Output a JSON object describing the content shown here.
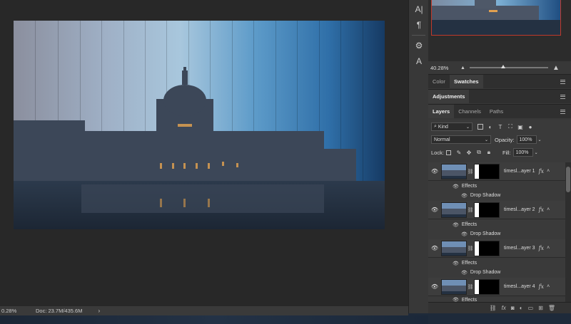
{
  "status": {
    "zoom": "0.28%",
    "doc": "Doc: 23.7M/435.6M",
    "arrow": "›"
  },
  "toolbar": {
    "icons": [
      "A|",
      "¶",
      "⚙",
      "A"
    ]
  },
  "navigator": {
    "zoom_value": "40.28%"
  },
  "tabs_top": [
    "Color",
    "Swatches"
  ],
  "tabs_mid": [
    "Adjustments"
  ],
  "tabs_layers": [
    "Layers",
    "Channels",
    "Paths"
  ],
  "layers": {
    "filter_kind": "Kind",
    "blend_mode": "Normal",
    "opacity_label": "Opacity:",
    "opacity_value": "100%",
    "lock_label": "Lock:",
    "fill_label": "Fill:",
    "fill_value": "100%",
    "items": [
      {
        "name": "timesl...ayer 1",
        "effects": "Effects",
        "effect": "Drop Shadow"
      },
      {
        "name": "timesl...ayer 2",
        "effects": "Effects",
        "effect": "Drop Shadow"
      },
      {
        "name": "timesl...ayer 3",
        "effects": "Effects",
        "effect": "Drop Shadow"
      },
      {
        "name": "timesl...ayer 4",
        "effects": "Effects"
      }
    ],
    "fx": "fx"
  },
  "colors": {
    "accent_red": "#c0392b",
    "panel": "#383838",
    "canvas": "#282828"
  }
}
